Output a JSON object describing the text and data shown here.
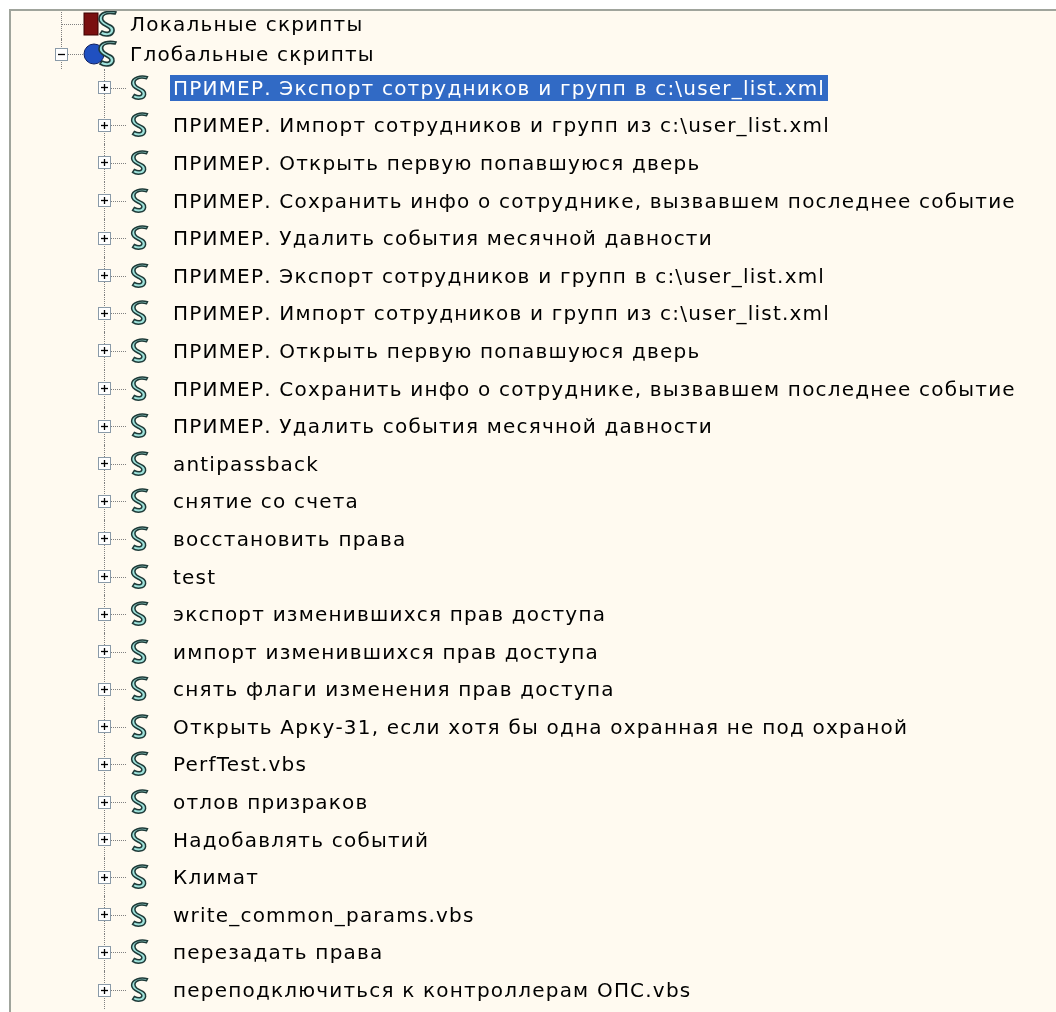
{
  "tree": [
    {
      "label": "Локальные скрипты",
      "kind": "local",
      "selected": false
    },
    {
      "label": "Глобальные скрипты",
      "kind": "global",
      "selected": false,
      "expanded": true,
      "children": [
        {
          "label": "ПРИМЕР. Экспорт сотрудников и групп в c:\\user_list.xml",
          "kind": "script",
          "selected": true,
          "expanded": false
        },
        {
          "label": "ПРИМЕР. Импорт сотрудников и групп из c:\\user_list.xml",
          "kind": "script",
          "selected": false,
          "expanded": false
        },
        {
          "label": "ПРИМЕР. Открыть первую попавшуюся дверь",
          "kind": "script",
          "selected": false,
          "expanded": false
        },
        {
          "label": "ПРИМЕР. Сохранить инфо о сотруднике, вызвавшем последнее событие",
          "kind": "script",
          "selected": false,
          "expanded": false
        },
        {
          "label": "ПРИМЕР. Удалить события месячной давности",
          "kind": "script",
          "selected": false,
          "expanded": false
        },
        {
          "label": "ПРИМЕР. Экспорт сотрудников и групп в c:\\user_list.xml",
          "kind": "script",
          "selected": false,
          "expanded": false
        },
        {
          "label": "ПРИМЕР. Импорт сотрудников и групп из c:\\user_list.xml",
          "kind": "script",
          "selected": false,
          "expanded": false
        },
        {
          "label": "ПРИМЕР. Открыть первую попавшуюся дверь",
          "kind": "script",
          "selected": false,
          "expanded": false
        },
        {
          "label": "ПРИМЕР. Сохранить инфо о сотруднике, вызвавшем последнее событие",
          "kind": "script",
          "selected": false,
          "expanded": false
        },
        {
          "label": "ПРИМЕР. Удалить события месячной давности",
          "kind": "script",
          "selected": false,
          "expanded": false
        },
        {
          "label": "antipassback",
          "kind": "script",
          "selected": false,
          "expanded": false
        },
        {
          "label": "снятие со счета",
          "kind": "script",
          "selected": false,
          "expanded": false
        },
        {
          "label": "восстановить права",
          "kind": "script",
          "selected": false,
          "expanded": false
        },
        {
          "label": "test",
          "kind": "script",
          "selected": false,
          "expanded": false
        },
        {
          "label": "экспорт изменившихся прав доступа",
          "kind": "script",
          "selected": false,
          "expanded": false
        },
        {
          "label": "импорт изменившихся прав доступа",
          "kind": "script",
          "selected": false,
          "expanded": false
        },
        {
          "label": "снять флаги изменения прав доступа",
          "kind": "script",
          "selected": false,
          "expanded": false
        },
        {
          "label": "Открыть Арку-31, если хотя бы одна охранная не под охраной",
          "kind": "script",
          "selected": false,
          "expanded": false
        },
        {
          "label": "PerfTest.vbs",
          "kind": "script",
          "selected": false,
          "expanded": false
        },
        {
          "label": "отлов призраков",
          "kind": "script",
          "selected": false,
          "expanded": false
        },
        {
          "label": "Надобавлять событий",
          "kind": "script",
          "selected": false,
          "expanded": false
        },
        {
          "label": "Климат",
          "kind": "script",
          "selected": false,
          "expanded": false
        },
        {
          "label": "write_common_params.vbs",
          "kind": "script",
          "selected": false,
          "expanded": false
        },
        {
          "label": "перезадать права",
          "kind": "script",
          "selected": false,
          "expanded": false
        },
        {
          "label": "переподключиться к контроллерам ОПС.vbs",
          "kind": "script",
          "selected": false,
          "expanded": false
        }
      ]
    }
  ]
}
